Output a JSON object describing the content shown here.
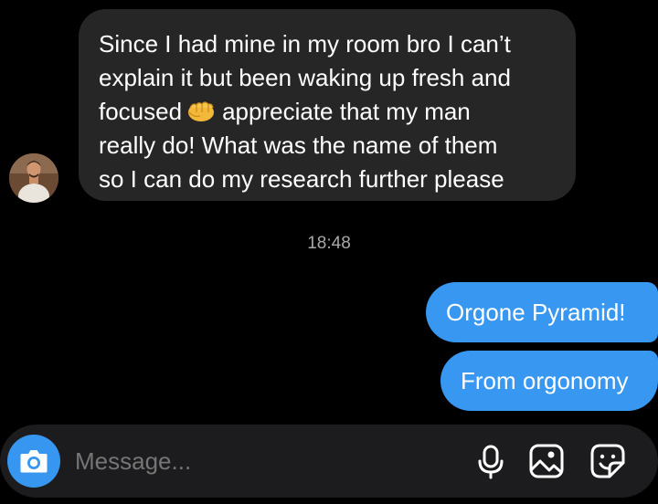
{
  "incoming_message": {
    "lines": [
      "Since I had mine in my room bro I can’t",
      "explain it but been waking up fresh and",
      "focused",
      "appreciate that my man",
      "really do! What was the name of them",
      "so I can do my research further please"
    ],
    "emoji": "oncoming-fist-emoji"
  },
  "timestamp": "18:48",
  "outgoing_messages": [
    "Orgone Pyramid!",
    "From orgonomy"
  ],
  "composer": {
    "placeholder": "Message...",
    "icons": [
      "camera-icon",
      "microphone-icon",
      "gallery-icon",
      "sticker-icon"
    ]
  },
  "colors": {
    "background": "#000000",
    "incoming_bubble": "#262626",
    "outgoing_bubble": "#3897f0",
    "composer": "#1c1c1e",
    "camera_button": "#3797f0",
    "timestamp": "#a8a8a8"
  }
}
